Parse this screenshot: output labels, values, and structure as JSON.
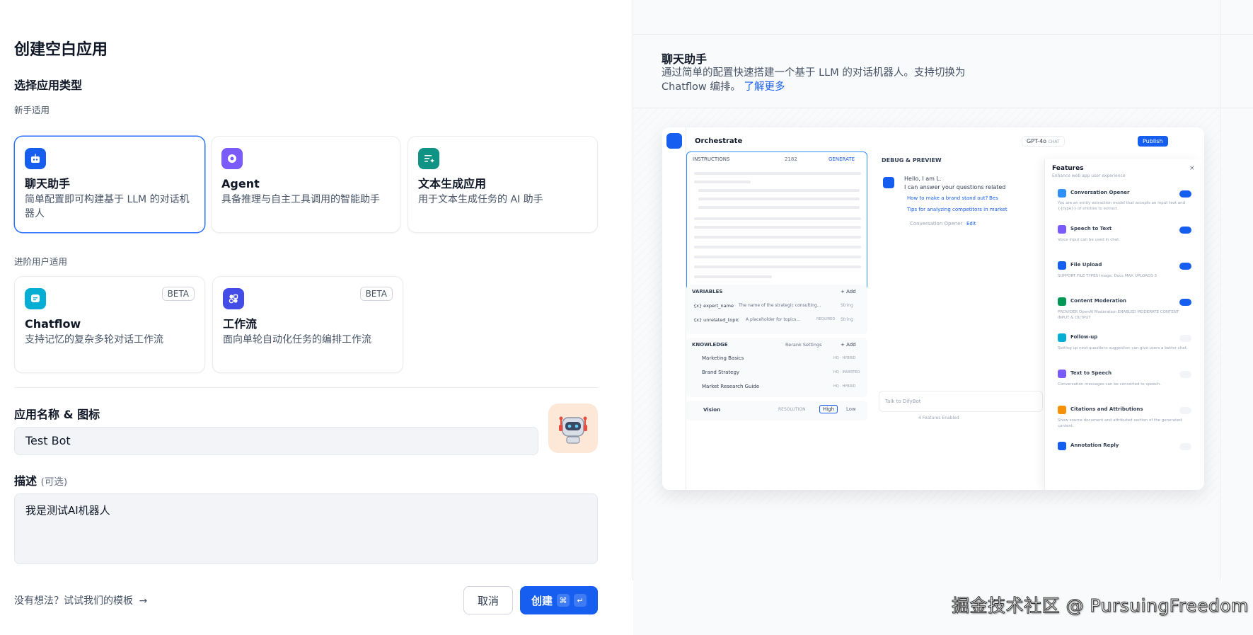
{
  "page": {
    "title": "创建空白应用"
  },
  "app_type": {
    "heading": "选择应用类型",
    "beginner_label": "新手适用",
    "advanced_label": "进阶用户适用",
    "beginner_cards": [
      {
        "title": "聊天助手",
        "desc": "简单配置即可构建基于 LLM 的对话机器人",
        "selected": true
      },
      {
        "title": "Agent",
        "desc": "具备推理与自主工具调用的智能助手"
      },
      {
        "title": "文本生成应用",
        "desc": "用于文本生成任务的 AI 助手"
      }
    ],
    "advanced_cards": [
      {
        "title": "Chatflow",
        "desc": "支持记忆的复杂多轮对话工作流",
        "badge": "BETA"
      },
      {
        "title": "工作流",
        "desc": "面向单轮自动化任务的编排工作流",
        "badge": "BETA"
      }
    ]
  },
  "form": {
    "name_label": "应用名称 & 图标",
    "name_value": "Test Bot",
    "desc_label": "描述",
    "desc_optional": "(可选)",
    "desc_value": "我是测试AI机器人"
  },
  "footer": {
    "template_link": "没有想法？试试我们的模板",
    "cancel": "取消",
    "create": "创建",
    "shortcut_cmd": "⌘",
    "shortcut_enter": "↵"
  },
  "info": {
    "title": "聊天助手",
    "desc": "通过简单的配置快速搭建一个基于 LLM 的对话机器人。支持切换为 Chatflow 编排。",
    "learn_more": "了解更多"
  },
  "preview": {
    "orchestrate": "Orchestrate",
    "model": "GPT-4o",
    "chat_tag": "CHAT",
    "publish": "Publish",
    "instructions": "INSTRUCTIONS",
    "count": "2182",
    "generate": "GENERATE",
    "debug": "DEBUG & PREVIEW",
    "greeting1": "Hello, I am L.",
    "greeting2": "I can answer your questions related",
    "q1": "How to make a brand stand out?",
    "q1b": "Bes",
    "q2": "Tips for analyzing competitors in market",
    "opener_note": "Conversation Opener",
    "edit": "Edit",
    "variables": "VARIABLES",
    "add": "+ Add",
    "var1_name": "{x} expert_name",
    "var1_desc": "The name of the strategic consulting...",
    "var1_type": "String",
    "var2_name": "{x} unrelated_topic",
    "var2_desc": "A placeholder for topics...",
    "var2_req": "REQUIRED",
    "var2_type": "String",
    "knowledge": "KNOWLEDGE",
    "rerank": "Rerank Settings",
    "kb": [
      {
        "name": "Marketing Basics",
        "tag": "HQ · HYBRID"
      },
      {
        "name": "Brand Strategy",
        "tag": "HQ · INVERTED"
      },
      {
        "name": "Market Research Guide",
        "tag": "HQ · HYBRID"
      }
    ],
    "vision": "Vision",
    "resolution": "RESOLUTION",
    "high": "High",
    "low": "Low",
    "talk": "Talk to DifyBot",
    "features_enabled": "4 Features Enabled",
    "features_title": "Features",
    "features_sub": "Enhance web app user experience",
    "features": [
      {
        "name": "Conversation Opener",
        "desc": "You are an entity extraction model that accepts an input text and {{type}} of entities to extract.",
        "on": true,
        "color": "#2e90fa"
      },
      {
        "name": "Speech to Text",
        "desc": "Voice input can be used in chat.",
        "on": true,
        "color": "#7a5af8"
      },
      {
        "name": "File Upload",
        "desc": "SUPPORT FILE TYPES  Image, Docs   MAX UPLOADS 3",
        "on": true,
        "color": "#155eef"
      },
      {
        "name": "Content Moderation",
        "desc": "PROVIDER OpenAI Moderation   ENABLED MODERATE CONTENT INPUT & OUTPUT",
        "on": true,
        "color": "#039855"
      },
      {
        "name": "Follow-up",
        "desc": "Setting up next questions suggestion can give users a better chat.",
        "on": false,
        "color": "#06aed4"
      },
      {
        "name": "Text to Speech",
        "desc": "Conversation messages can be converted to speech.",
        "on": false,
        "color": "#7a5af8"
      },
      {
        "name": "Citations and Attributions",
        "desc": "Show source document and attributed section of the generated content.",
        "on": false,
        "color": "#f79009"
      },
      {
        "name": "Annotation Reply",
        "desc": "",
        "on": false,
        "color": "#155eef"
      }
    ]
  },
  "watermark": "掘金技术社区 @ PursuingFreedom",
  "colors": {
    "accent": "#155eef",
    "selected_border": "#2970ff"
  }
}
